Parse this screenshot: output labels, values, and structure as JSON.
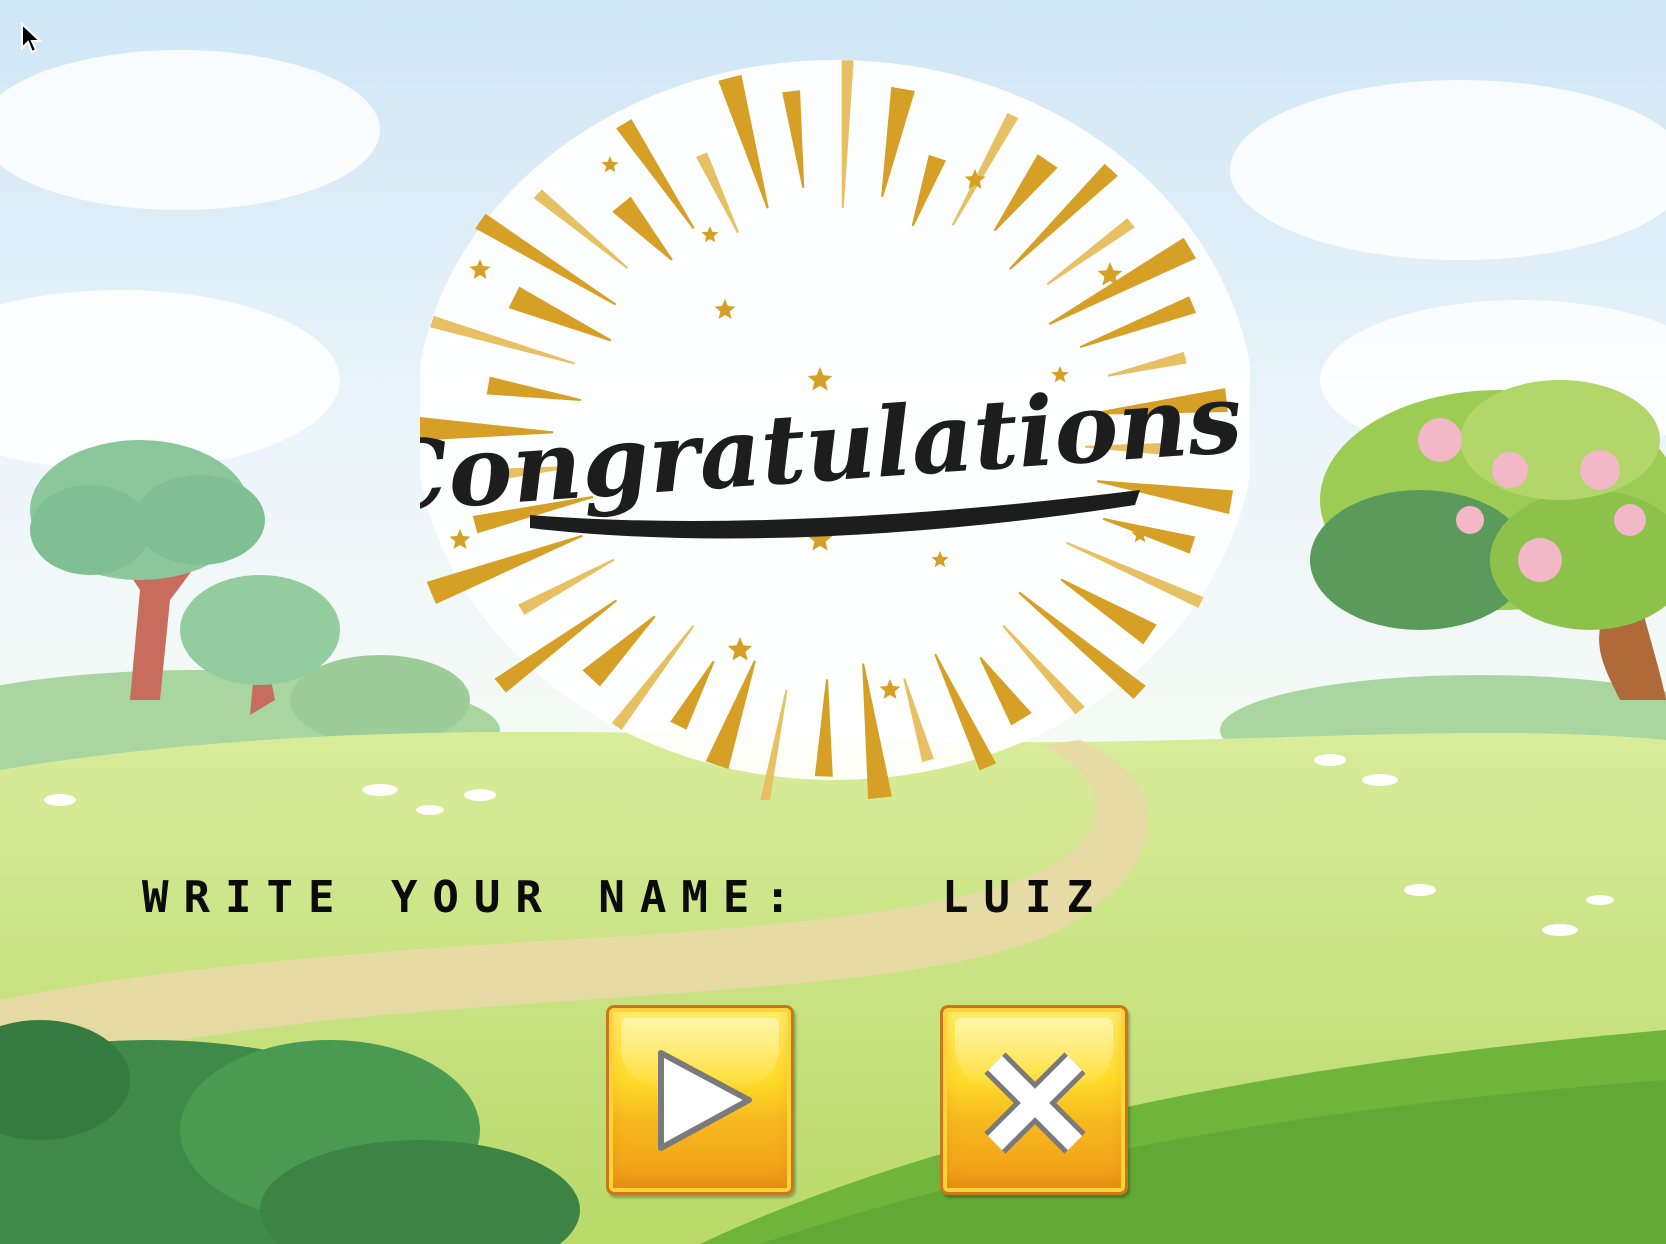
{
  "title_banner": {
    "text": "Congratulations!"
  },
  "name_prompt": {
    "label": "WRITE YOUR NAME:",
    "value": "LUIZ"
  },
  "buttons": {
    "play_icon": "play-icon",
    "close_icon": "close-x-icon"
  },
  "colors": {
    "sky": "#d9ecf7",
    "grass": "#c5e07a",
    "path": "#e7d8a6",
    "burst_gold": "#d9a42b",
    "button_yellow": "#ffd62a",
    "button_orange": "#f19a16",
    "text": "#0b0b0b"
  }
}
